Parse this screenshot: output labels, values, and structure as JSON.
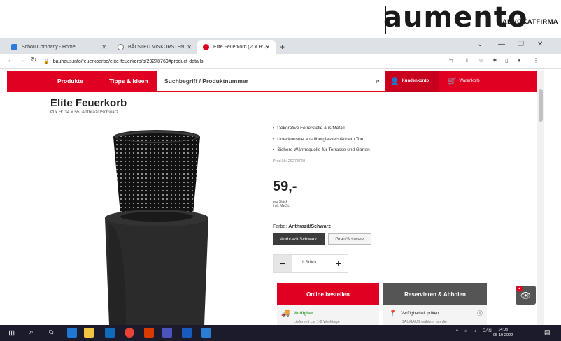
{
  "watermark": {
    "brand": "aumento",
    "subtitle": "ADVOKATFIRMA"
  },
  "browser": {
    "tabs": [
      {
        "label": "Schou Company - Home",
        "color": "#2f7bd8"
      },
      {
        "label": "BÅLSTED M/SKORSTEN",
        "color": "#777777"
      },
      {
        "label": "Elite Feuerkorb (Ø x H: 34 x 55, A",
        "color": "#e00022"
      }
    ],
    "url": "bauhaus.info/feuerkoerbe/elite-feuerkorb/p/29278769#product-details"
  },
  "site": {
    "nav": {
      "products": "Produkte",
      "tips": "Tipps & Ideen"
    },
    "search_placeholder": "Suchbegriff / Produktnummer",
    "customer_account": "Kundenkonto",
    "cart": "Warenkorb"
  },
  "product": {
    "title": "Elite Feuerkorb",
    "subtitle": "Ø x H: 34 x 55, Anthrazit/Schwarz",
    "bullets": [
      "Dekorative Feuerstelle aus Metall",
      "Unterkonsole aus fiberglasverstärktem Ton",
      "Sichere Wärmequelle für Terrasse und Garten"
    ],
    "product_number": "Prod.Nr. 29278769",
    "price": "59,-",
    "price_unit": "pro Stück",
    "price_vat": "inkl. MwSt.",
    "color_label": "Farbe:",
    "color_value": "Anthrazit/Schwarz",
    "color_options": [
      "Anthrazit/Schwarz",
      "Grau/Schwarz"
    ],
    "quantity": "1 Stück",
    "order_button": "Online bestellen",
    "reserve_button": "Reservieren & Abholen",
    "available": "Verfügbar",
    "available_sub": "Lieferzeit ca. 1-2 Werktage",
    "check_availability": "Verfügbarkeit prüfen",
    "check_sub": "BAUHAUS wählen, um die"
  },
  "taskbar": {
    "lang": "DAN",
    "time": "14:03",
    "date": "05-10-2022"
  },
  "colors": {
    "brand_red": "#e00022",
    "dark_button": "#555555"
  }
}
